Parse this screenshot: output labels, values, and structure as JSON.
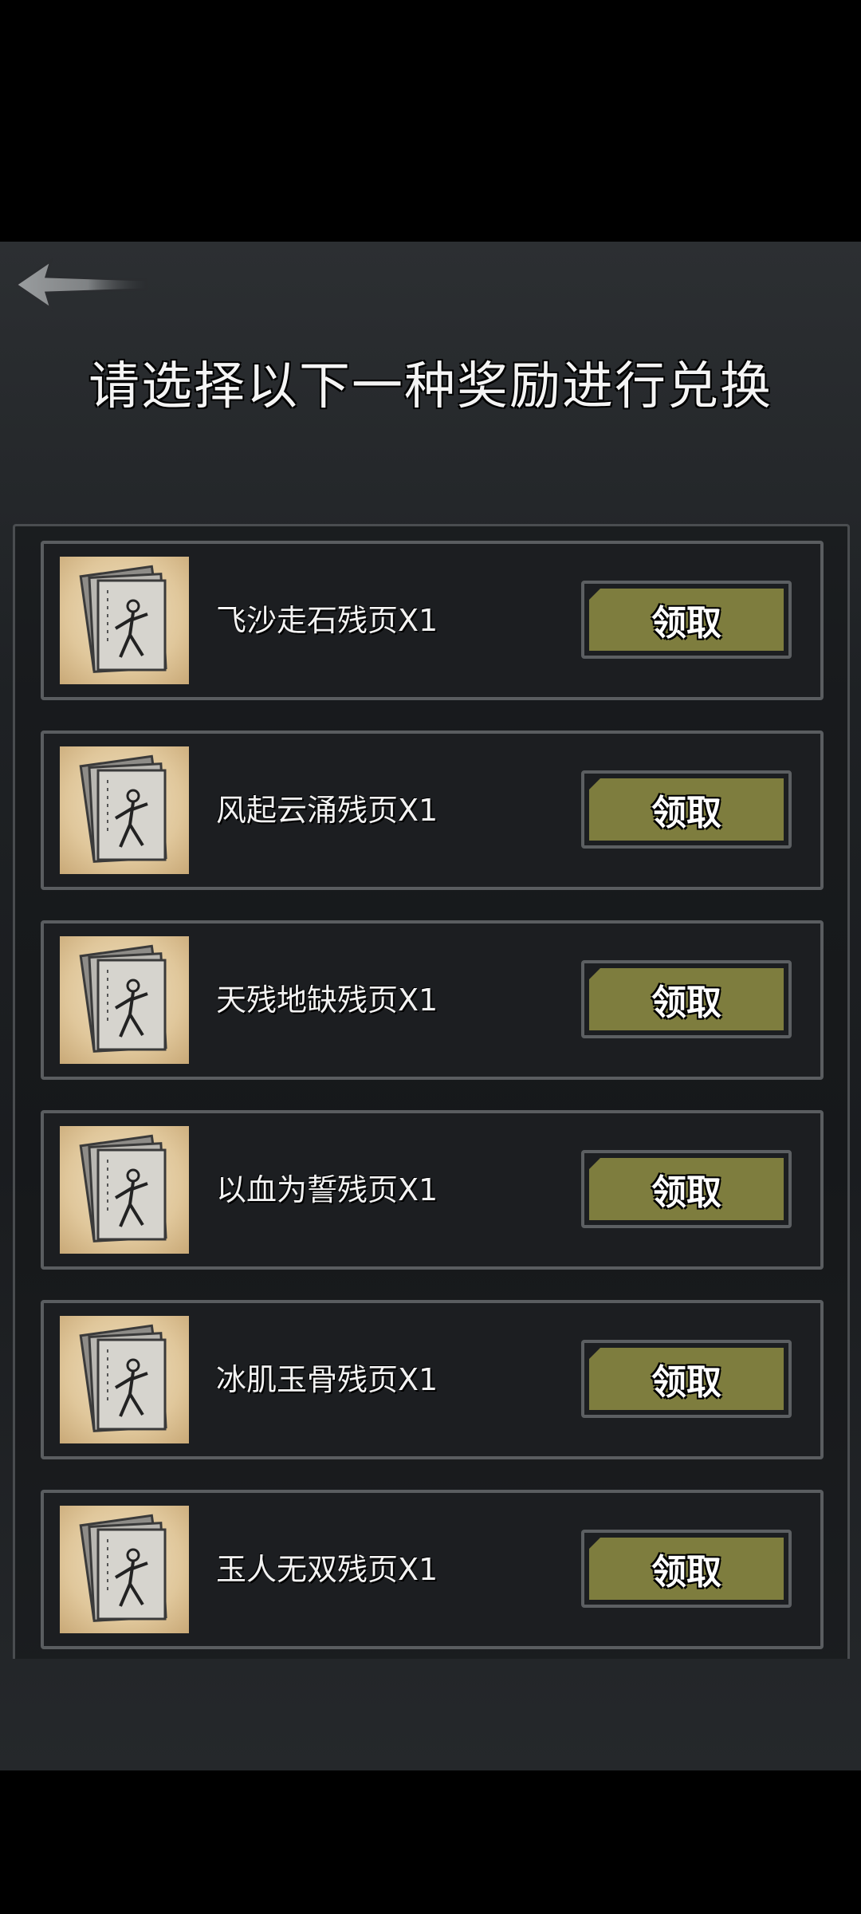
{
  "page": {
    "title": "请选择以下一种奖励进行兑换",
    "back_icon": "back-arrow-icon"
  },
  "rewards": [
    {
      "name": "飞沙走石残页X1",
      "button": "领取"
    },
    {
      "name": "风起云涌残页X1",
      "button": "领取"
    },
    {
      "name": "天残地缺残页X1",
      "button": "领取"
    },
    {
      "name": "以血为誓残页X1",
      "button": "领取"
    },
    {
      "name": "冰肌玉骨残页X1",
      "button": "领取"
    },
    {
      "name": "玉人无双残页X1",
      "button": "领取"
    }
  ],
  "colors": {
    "button_fill": "#7e7d3e",
    "border": "#5a5d60",
    "background": "#1e2124"
  }
}
